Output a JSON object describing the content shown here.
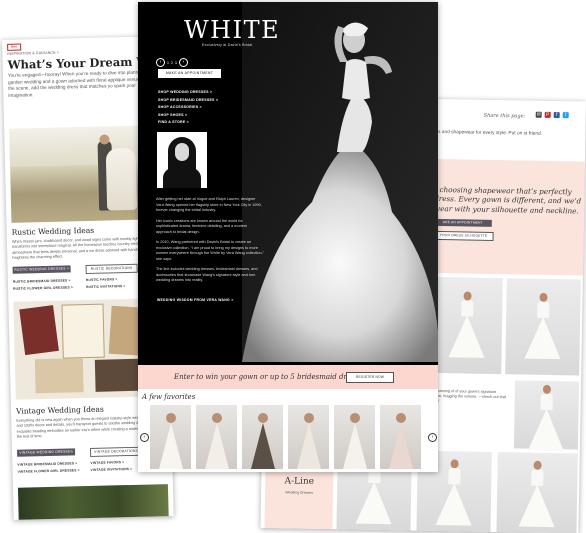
{
  "left_page": {
    "logo_text": "Bee",
    "breadcrumb": "INSPIRATION & GUIDANCE >",
    "title": "What’s Your Dream Wed",
    "intro": "You’re engaged—hooray! When you’re ready to dive into planni of a garden wedding and a gown adorned with floral applique venue to set the scene, add the wedding dress that matches yo spark your imagination.",
    "rustic": {
      "heading": "Rustic Wedding Ideas",
      "text": "When mason jars, chalkboard decor, and wood signs come with twinkly light ordinary barn transforms into someplace magical. All the homespun touches country wedding create an atmosphere that feels deeply personal, and a wo dress adorned with handcrafted lace heightens the charming effect.",
      "btn_dresses": "RUSTIC WEDDING DRESSES >",
      "btn_decorations": "RUSTIC DECORATIONS",
      "links": [
        "RUSTIC BRIDESMAID DRESSES >",
        "RUSTIC FAVORS >",
        "RUSTIC FLOWER GIRL DRESSES >",
        "RUSTIC INVITATIONS >"
      ]
    },
    "vintage": {
      "heading": "Vintage Wedding Ideas",
      "text": "Everything old is new again when you throw an elegant Gatsby-style weddi vintage 1920s and 1930s decor and details, you’ll transport guests to anothe wedding dress covered in exquisite beading embodies an earlier era’s refine while creating a statement that stands the test of time.",
      "btn_dresses": "VINTAGE WEDDING DRESSES",
      "btn_decorations": "VINTAGE DECORATIONS",
      "links": [
        "VINTAGE BRIDESMAID DRESSES >",
        "VINTAGE FAVORS >",
        "VINTAGE FLOWER GIRL DRESSES >",
        "VINTAGE INVITATIONS >"
      ]
    }
  },
  "center_page": {
    "brand": "WHITE",
    "brand_sub": "Exclusively at David’s Bridal",
    "pager": [
      "1",
      "2",
      "3"
    ],
    "appointment_button": "MAKE AN APPOINTMENT",
    "nav": [
      "SHOP WEDDING DRESSES >",
      "SHOP BRIDESMAID DRESSES >",
      "SHOP ACCESSORIES >",
      "SHOP SHOES >",
      "FIND A STORE >"
    ],
    "bio": [
      "After getting her start at Vogue and Ralph Lauren, designer Vera Wang opened her flagship store in New York City in 1990, forever changing the bridal industry.",
      "Her iconic creations are known around the world for sophisticated drama, feminine detailing, and a modern approach to bridal design.",
      "In 2010, Wang partnered with David’s Bridal to create an exclusive collection. “I am proud to bring my designs to more women everywhere through the White by Vera Wang collection,” she says.",
      "The line includes wedding dresses, bridesmaid dresses, and accessories that showcase Wang’s signature style and turn wedding dreams into reality."
    ],
    "ww_link": "WEDDING WISDOM FROM VERA WANG >",
    "contest_text": "Enter to win your gown or up to 5 bridesmaid dresses!",
    "register_button": "REGISTER NOW",
    "favorites_label": "A few favorites",
    "favorites_count": 6
  },
  "right_page": {
    "share_label": "Share this page:",
    "share_icons": [
      {
        "name": "email-icon",
        "glyph": "✉",
        "color": "#444444"
      },
      {
        "name": "pinterest-icon",
        "glyph": "P",
        "color": "#c8232c"
      },
      {
        "name": "facebook-icon",
        "glyph": "f",
        "color": "#3b5998"
      },
      {
        "name": "twitter-icon",
        "glyph": "t",
        "color": "#1da1f2"
      }
    ],
    "intro": "ps and shapewear for every style. Put on st friend.",
    "quote": "t choosing shapewear that’s perfectly dress. Every gown is different, and we’d wear with your silhouette and neckline.",
    "btn_appointment": "AKE AN APPOINTMENT",
    "btn_silhouette": "YOUR DRESS SILHOUETTE",
    "detail_text": "e dreaming of of your gown’s signature shape, hugging the volume. —check out that skirt!",
    "aline_title": "A-Line",
    "aline_sub": "Wedding Dresses"
  },
  "colors": {
    "pink_band": "#fbe4dc",
    "contest_band": "#fbd7d0",
    "dark_button": "#5b5562"
  }
}
